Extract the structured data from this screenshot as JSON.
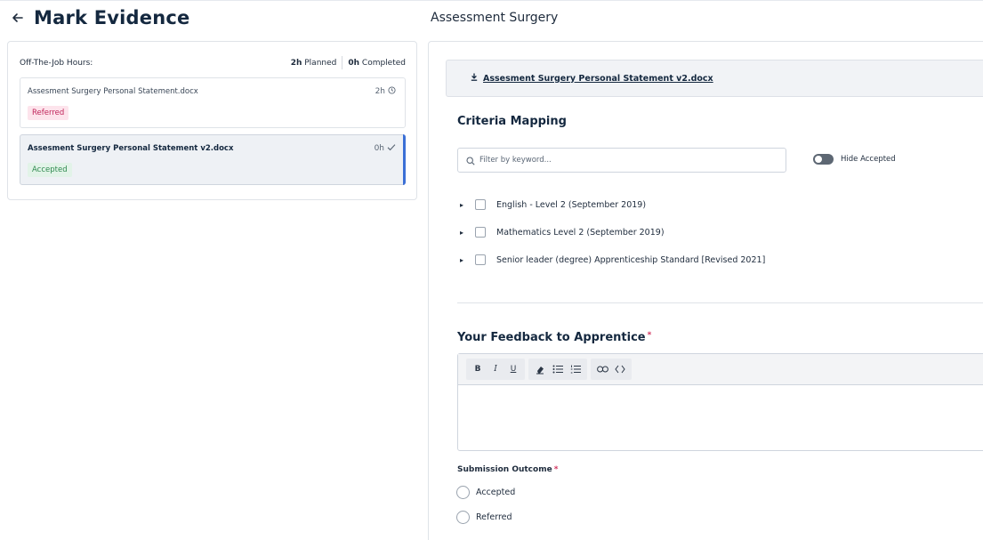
{
  "header": {
    "title": "Mark Evidence",
    "back_icon": "arrow-left-icon",
    "right_title": "Assessment Surgery"
  },
  "left_panel": {
    "hours_label": "Off-The-Job Hours:",
    "planned_value": "2h",
    "planned_label": "Planned",
    "completed_value": "0h",
    "completed_label": "Completed",
    "evidence": [
      {
        "name": "Assesment Surgery Personal Statement.docx",
        "hours": "2h",
        "status_icon": "clock-icon",
        "badge": "Referred",
        "active": false
      },
      {
        "name": "Assesment Surgery Personal Statement v2.docx",
        "hours": "0h",
        "status_icon": "check-icon",
        "badge": "Accepted",
        "active": true
      }
    ]
  },
  "right_panel": {
    "file_link": "Assesment Surgery Personal Statement v2.docx",
    "file_icon": "download-icon",
    "criteria_title": "Criteria Mapping",
    "filter_placeholder": "Filter by keyword...",
    "hide_accepted_label": "Hide Accepted",
    "criteria": [
      "English - Level 2 (September 2019)",
      "Mathematics Level 2 (September 2019)",
      "Senior leader (degree) Apprenticeship Standard [Revised 2021]"
    ],
    "feedback_title": "Your Feedback to Apprentice",
    "required_mark": "*",
    "toolbar": {
      "bold": "B",
      "italic": "I",
      "underline": "U"
    },
    "outcome_label": "Submission Outcome",
    "outcomes": [
      "Accepted",
      "Referred"
    ]
  },
  "colors": {
    "accent": "#3b6fd6",
    "referred_bg": "#fde4ec",
    "referred_text": "#c0245a",
    "accepted_bg": "#e2f3e8",
    "accepted_text": "#2f8a4f",
    "title": "#14283f"
  }
}
